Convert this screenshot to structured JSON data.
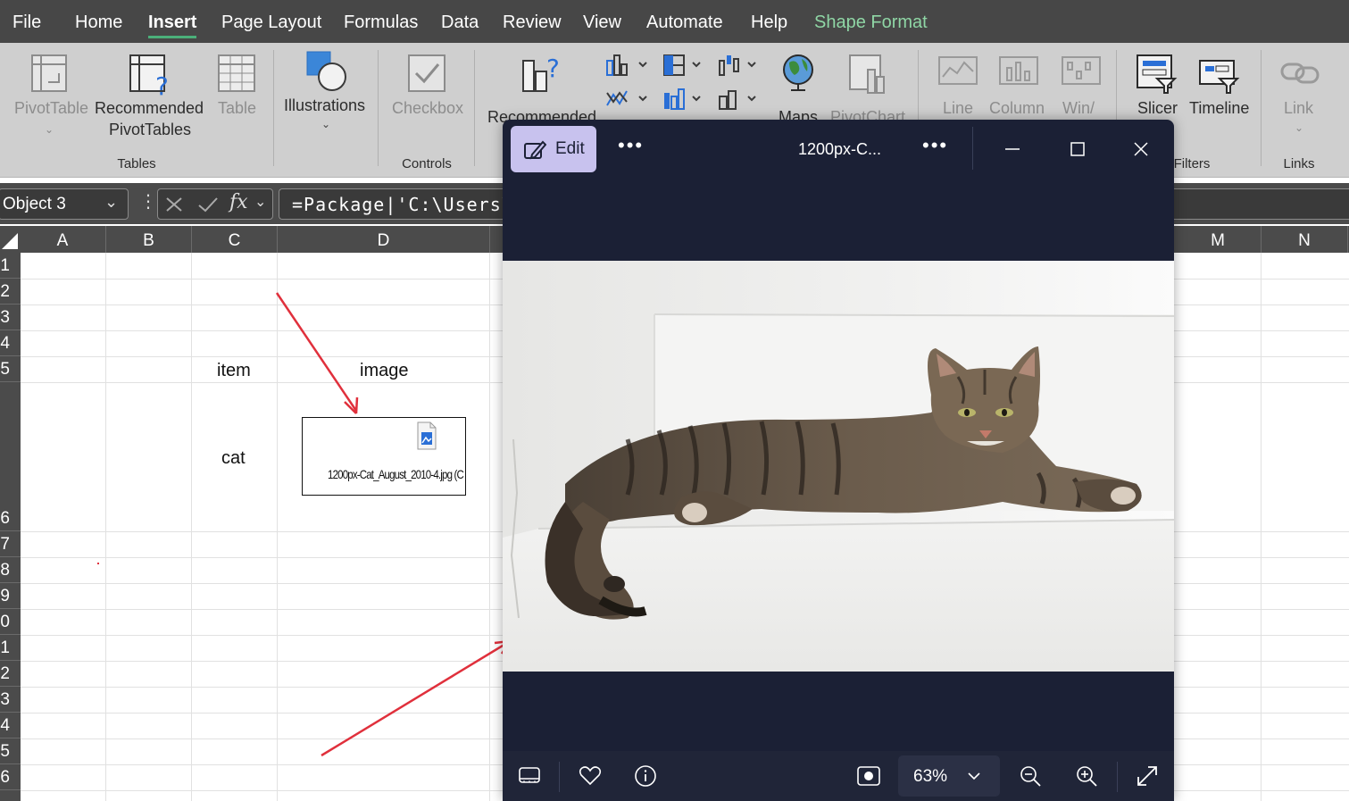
{
  "menu": {
    "file": "File",
    "home": "Home",
    "insert": "Insert",
    "page_layout": "Page Layout",
    "formulas": "Formulas",
    "data": "Data",
    "review": "Review",
    "view": "View",
    "automate": "Automate",
    "help": "Help",
    "shape_format": "Shape Format"
  },
  "ribbon": {
    "pivottable": "PivotTable",
    "recommended_pivot_1": "Recommended",
    "recommended_pivot_2": "PivotTables",
    "table": "Table",
    "illustrations": "Illustrations",
    "checkbox": "Checkbox",
    "recommended_charts": "Recommended",
    "maps": "Maps",
    "pivotchart": "PivotChart",
    "line": "Line",
    "column": "Column",
    "winloss": "Win/",
    "slicer": "Slicer",
    "timeline": "Timeline",
    "link": "Link",
    "groups": {
      "tables": "Tables",
      "controls": "Controls",
      "filters": "Filters",
      "links": "Links"
    }
  },
  "formula_bar": {
    "name_box": "Object 3",
    "formula": "=Package|'C:\\Users\\c",
    "fx": "fx"
  },
  "columns": [
    "A",
    "B",
    "C",
    "D",
    "M",
    "N"
  ],
  "rows": [
    "1",
    "2",
    "3",
    "4",
    "5",
    "6",
    "7",
    "8",
    "9",
    "0",
    "1",
    "2",
    "3",
    "4",
    "5",
    "6"
  ],
  "cells": {
    "c5": "item",
    "d5": "image",
    "c6": "cat",
    "embedded_file": "1200px-Cat_August_2010-4.jpg (C"
  },
  "viewer": {
    "edit_label": "Edit",
    "title": "1200px-C...",
    "zoom": "63%",
    "photo_alt": "Tabby cat lying on a white ledge"
  },
  "colors": {
    "excel_green": "#4bb07a",
    "arrow_red": "#e0303c",
    "viewer_bg": "#1b2035",
    "edit_button": "#c8c2ee"
  }
}
